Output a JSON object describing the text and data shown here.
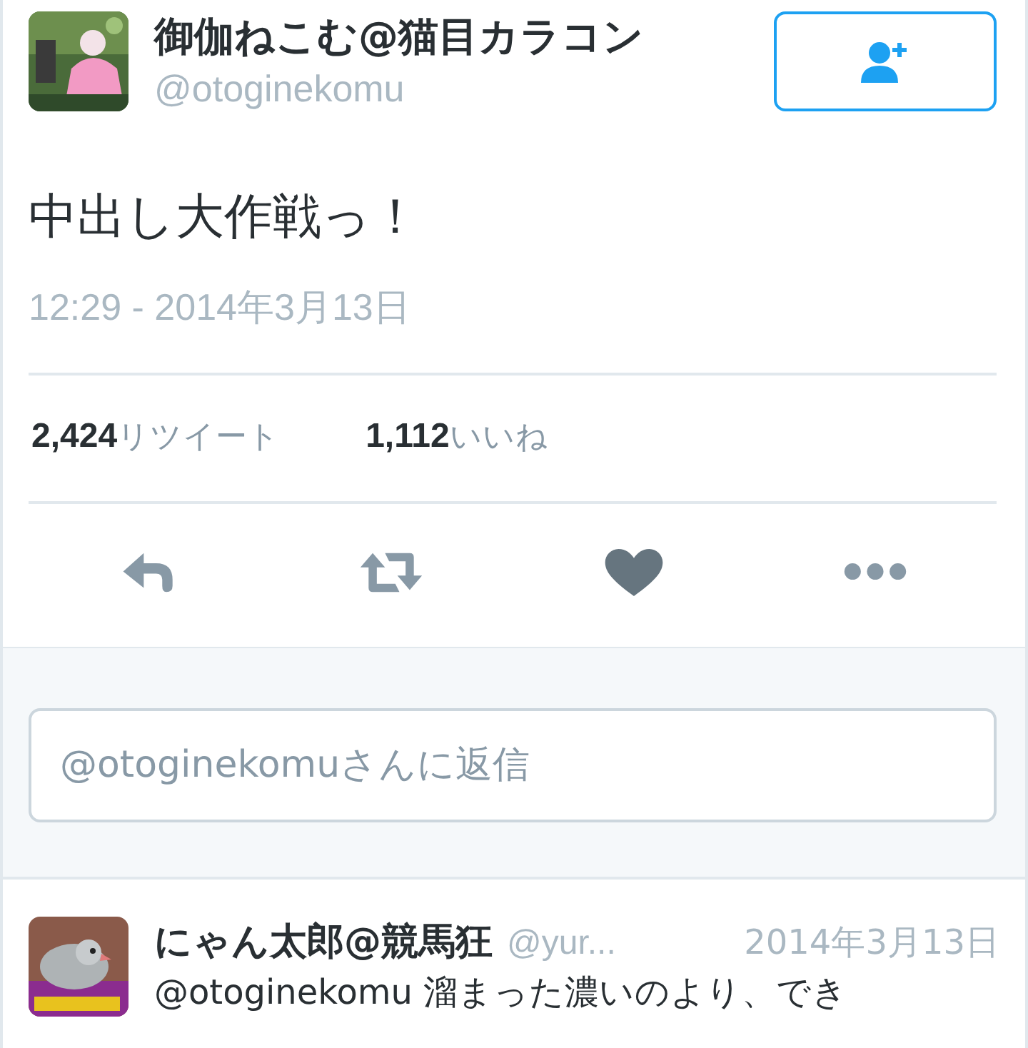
{
  "tweet": {
    "author": {
      "name": "御伽ねこむ@猫目カラコン",
      "handle": "@otoginekomu"
    },
    "text": "中出し大作戦っ！",
    "timestamp": "12:29 - 2014年3月13日",
    "stats": [
      {
        "count": "2,424",
        "label": "リツイート"
      },
      {
        "count": "1,112",
        "label": "いいね"
      }
    ],
    "actions": [
      {
        "kind": "reply"
      },
      {
        "kind": "retweet"
      },
      {
        "kind": "like"
      },
      {
        "kind": "more"
      }
    ]
  },
  "reply_field": {
    "placeholder": "@otoginekomuさんに返信"
  },
  "replies": [
    {
      "name": "にゃん太郎@競馬狂",
      "handle": "@yur...",
      "date": "2014年3月13日",
      "text": "@otoginekomu 溜まった濃いのより、でき"
    }
  ]
}
